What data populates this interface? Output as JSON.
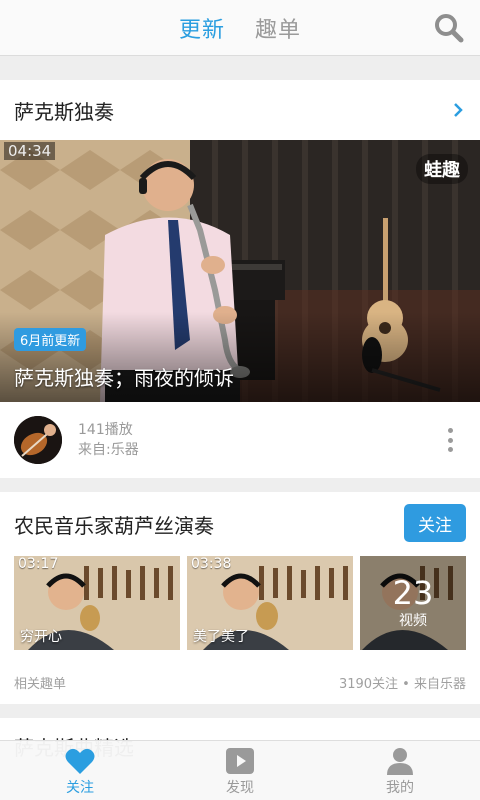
{
  "header": {
    "tabs": [
      {
        "label": "更新",
        "active": true
      },
      {
        "label": "趣单",
        "active": false
      }
    ],
    "search_icon": "search-icon"
  },
  "card1": {
    "title": "萨克斯独奏",
    "video": {
      "duration": "04:34",
      "watermark": "蛙趣",
      "badge": "6月前更新",
      "title": "萨克斯独奏；雨夜的倾诉"
    },
    "plays": "141播放",
    "source": "来自:乐器"
  },
  "card2": {
    "title": "农民音乐家葫芦丝演奏",
    "follow_label": "关注",
    "thumbs": [
      {
        "duration": "03:17",
        "caption": "穷开心"
      },
      {
        "duration": "03:38",
        "caption": "美了美了"
      }
    ],
    "more_count": "23",
    "more_unit": "视频",
    "footer_left": "相关趣单",
    "footer_right": "3190关注 • 来自乐器"
  },
  "card3": {
    "title": "萨克斯曲精选"
  },
  "bottom_nav": [
    {
      "label": "关注",
      "icon": "heart-icon",
      "active": true
    },
    {
      "label": "发现",
      "icon": "play-icon",
      "active": false
    },
    {
      "label": "我的",
      "icon": "person-icon",
      "active": false
    }
  ],
  "colors": {
    "accent": "#2b9ee0",
    "badge": "#2f9be0",
    "inactive": "#9a9a9a"
  }
}
